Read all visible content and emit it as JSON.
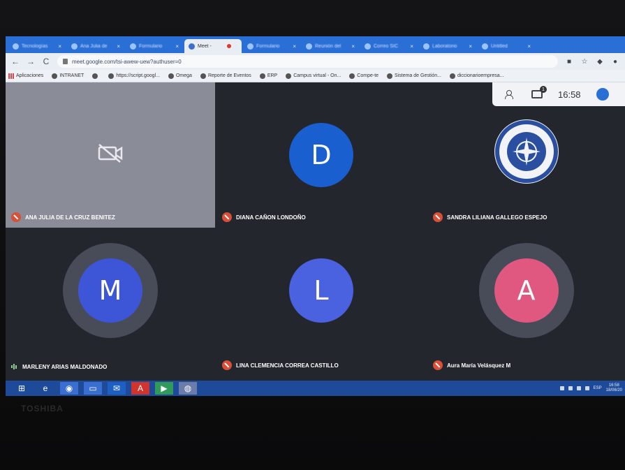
{
  "browser": {
    "tabs": [
      {
        "label": "Tecnologías",
        "active": false
      },
      {
        "label": "Ana Julia de",
        "active": false
      },
      {
        "label": "Formulario",
        "active": false
      },
      {
        "label": "Meet -",
        "active": true
      },
      {
        "label": "Formulario",
        "active": false
      },
      {
        "label": "Reunión del",
        "active": false
      },
      {
        "label": "Correo SIC",
        "active": false
      },
      {
        "label": "Laboratorio",
        "active": false
      },
      {
        "label": "Untitled",
        "active": false
      }
    ],
    "url": "meet.google.com/tsi-awew-uew?authuser=0",
    "bookmarks": [
      {
        "label": "Aplicaciones",
        "icon": "apps-icon"
      },
      {
        "label": "INTRANET",
        "icon": "globe-icon"
      },
      {
        "label": "",
        "icon": "globe-icon"
      },
      {
        "label": "https://script.googl...",
        "icon": "script-icon"
      },
      {
        "label": "Omega",
        "icon": "globe-icon"
      },
      {
        "label": "Reporte de Eventos",
        "icon": "globe-icon"
      },
      {
        "label": "ERP",
        "icon": "globe-icon"
      },
      {
        "label": "Campus virtual - On...",
        "icon": "globe-icon"
      },
      {
        "label": "Compe-te",
        "icon": "globe-icon"
      },
      {
        "label": "Sistema de Gestión...",
        "icon": "globe-icon"
      },
      {
        "label": "diccionarioempresa...",
        "icon": "globe-icon"
      }
    ]
  },
  "meet": {
    "time": "16:58",
    "chat_badge": "1",
    "participants": [
      {
        "name": "ANA JULIA DE LA CRUZ BENITEZ",
        "type": "camera-off",
        "mic": "muted"
      },
      {
        "name": "DIANA CAÑON LONDOÑO",
        "initial": "D",
        "color": "#1a5fd0",
        "mic": "muted"
      },
      {
        "name": "SANDRA LILIANA GALLEGO ESPEJO",
        "type": "logo",
        "mic": "muted"
      },
      {
        "name": "MARLENY ARIAS MALDONADO",
        "initial": "M",
        "color": "#3d56d8",
        "mic": "speaking"
      },
      {
        "name": "LINA CLEMENCIA CORREA CASTILLO",
        "initial": "L",
        "color": "#4a62e0",
        "mic": "muted"
      },
      {
        "name": "Aura María Velásquez M",
        "initial": "A",
        "color": "#e0587f",
        "mic": "muted"
      }
    ]
  },
  "taskbar": {
    "apps": [
      "windows-start-icon",
      "ie-icon",
      "chrome-icon",
      "explorer-icon",
      "outlook-icon",
      "acrobat-icon",
      "meet-icon",
      "app-icon"
    ],
    "lang": "ESP",
    "clock_time": "16:58",
    "clock_date": "18/06/20"
  },
  "device_brand": "TOSHIBA",
  "colors": {
    "tab_strip": "#2a6fd6",
    "meet_bg": "#24262e",
    "taskbar": "#1e4a9a",
    "mic_muted": "#d94f37"
  }
}
